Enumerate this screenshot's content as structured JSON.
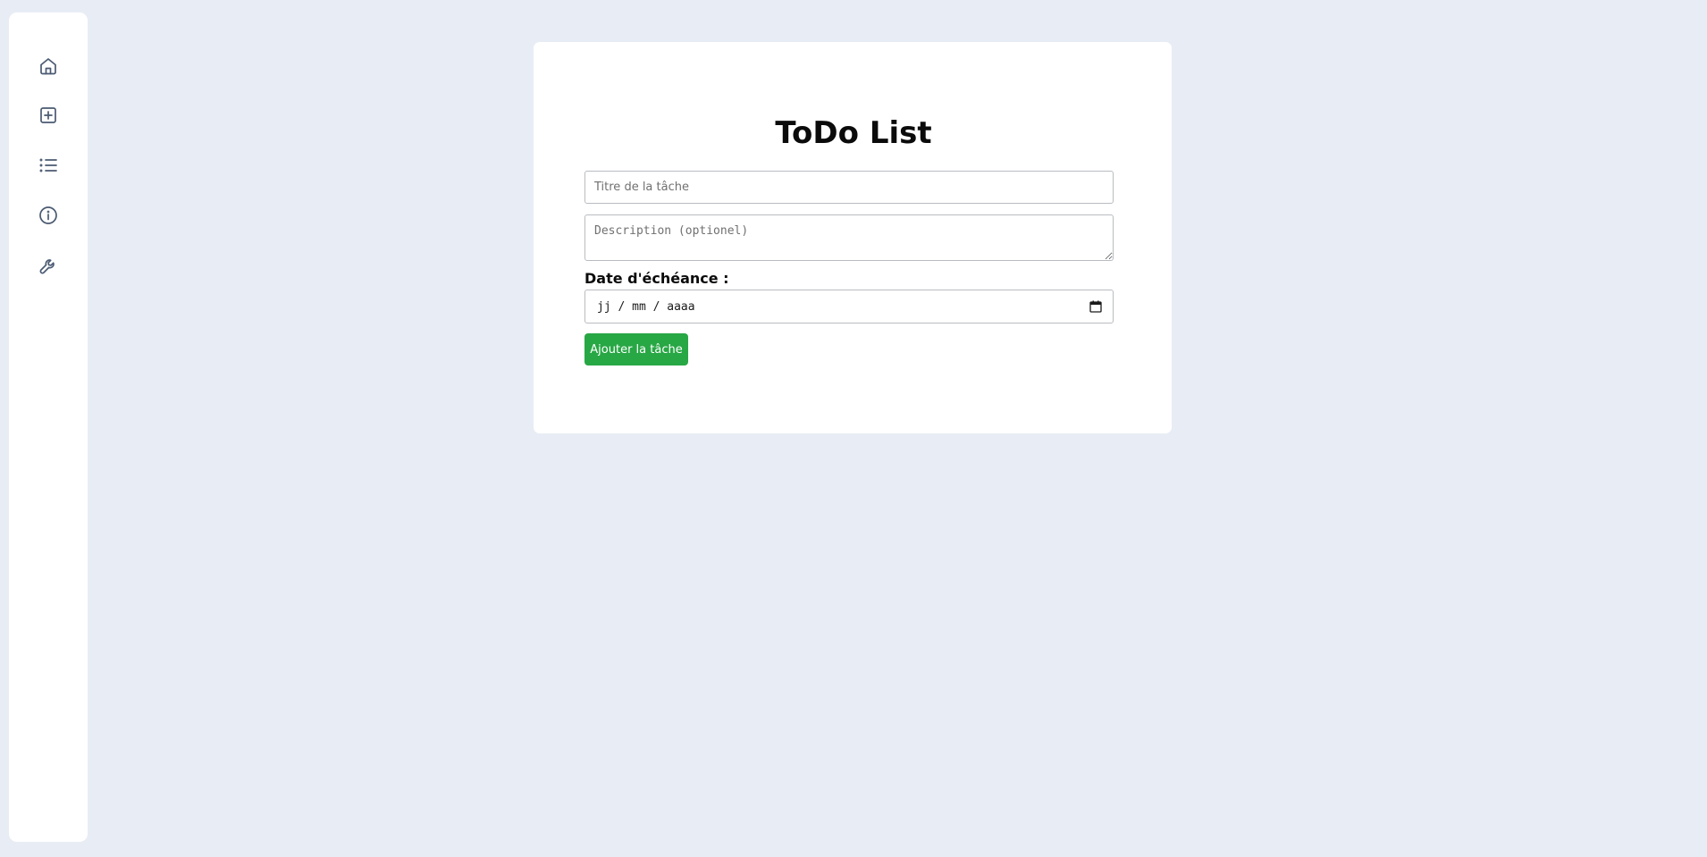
{
  "sidebar": {
    "items": [
      {
        "icon": "home-icon"
      },
      {
        "icon": "add-square-icon"
      },
      {
        "icon": "list-icon"
      },
      {
        "icon": "info-icon"
      },
      {
        "icon": "wrench-icon"
      }
    ]
  },
  "main": {
    "title": "ToDo List",
    "title_input": {
      "placeholder": "Titre de la tâche",
      "value": ""
    },
    "description_input": {
      "placeholder": "Description (optionel)",
      "value": ""
    },
    "date_label": "Date d'échéance :",
    "date_input": {
      "placeholder": "jj / mm / aaaa",
      "icon": "calendar-icon"
    },
    "add_button_label": "Ajouter la tâche"
  },
  "colors": {
    "background": "#e8edf5",
    "card": "#ffffff",
    "button": "#28a745",
    "icon": "#4a5a72"
  }
}
